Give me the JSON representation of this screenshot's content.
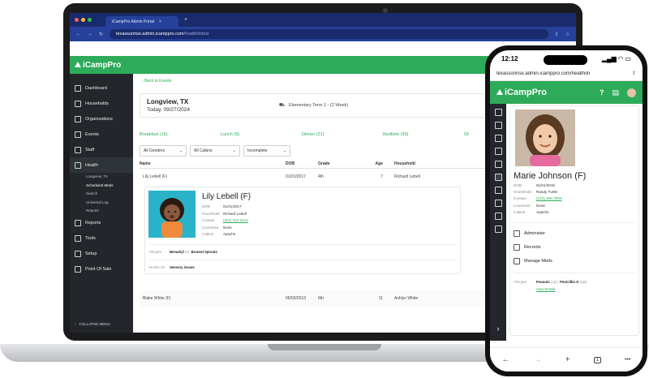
{
  "browser": {
    "tab_title": "iCampPro Admin Portal",
    "new_tab": "+",
    "url_host": "texassunrise.admin.icamppro.com",
    "url_path": "/health/inbox"
  },
  "app": {
    "brand": "iCampPro"
  },
  "sidebar": {
    "items": [
      {
        "label": "Dashboard"
      },
      {
        "label": "Households"
      },
      {
        "label": "Organizations"
      },
      {
        "label": "Events"
      },
      {
        "label": "Staff"
      },
      {
        "label": "Health"
      }
    ],
    "health_sub": [
      "Longview, TX",
      "Scheduled Meds",
      "Search",
      "Universal Log",
      "Reports"
    ],
    "items_after": [
      {
        "label": "Reports"
      },
      {
        "label": "Tools"
      },
      {
        "label": "Setup"
      },
      {
        "label": "Point Of Sale"
      }
    ],
    "collapse": "COLLAPSE MENU"
  },
  "main": {
    "back": "Back to Events",
    "event_location": "Longview, TX",
    "event_date": "Today, 09/27/2024",
    "term": "Elementary Term 1 - (2 Week)",
    "meals": [
      "Breakfast (15)",
      "Lunch (5)",
      "Dinner (21)",
      "Bedtime (30)",
      "Ot"
    ],
    "filters": [
      "All Genders",
      "All Cabins",
      "Incomplete"
    ],
    "columns": [
      "Name",
      "DOB",
      "Grade",
      "Age",
      "Household"
    ],
    "row1": {
      "name": "Lily Lebell (F)",
      "dob": "01/01/2017",
      "grade": "4th",
      "age": "7",
      "household": "Richard Lebell"
    },
    "detail": {
      "name": "Lily Lebell",
      "gender": "(F)",
      "fields": [
        {
          "k": "DOB",
          "v": "01/01/2017"
        },
        {
          "k": "Household",
          "v": "Richard Lebell"
        },
        {
          "k": "Contact",
          "v": "(321) 321-3214"
        },
        {
          "k": "Counselor",
          "v": "None"
        },
        {
          "k": "Cabins",
          "v": "Apache"
        }
      ],
      "allergies_label": "Allergies",
      "allergy1": "Benadryl",
      "allergy1_sev": "(5)",
      "allergy2": "Brussel Sprouts",
      "health_label": "Health Info",
      "health_value": "Sensory issues"
    },
    "row2": {
      "name": "Blake White (F)",
      "dob": "06/03/2013",
      "grade": "6th",
      "age": "11",
      "household": "Ashlyn White"
    }
  },
  "phone": {
    "time": "12:12",
    "url": "texassunrise.admin.icamppro.com/health/in",
    "brand": "iCampPro",
    "camper": {
      "name": "Marie Johnson",
      "gender": "(F)",
      "fields": [
        {
          "k": "DOB",
          "v": "01/01/2015"
        },
        {
          "k": "Household",
          "v": "Randy Turtle"
        },
        {
          "k": "Contact",
          "v": "(123) 456-7899"
        },
        {
          "k": "Counselor",
          "v": "None"
        },
        {
          "k": "Cabins",
          "v": "Apache"
        }
      ]
    },
    "actions": [
      "Administer",
      "Records",
      "Manage Meds"
    ],
    "allergies_label": "Allergies",
    "allergy1": "Peanuts",
    "allergy1_sev": "(1pt)",
    "allergy2": "Penicillin G",
    "allergy2_sev": "(6pt)",
    "view_details": "View Details",
    "nav": [
      "←",
      "→",
      "+",
      "1",
      "•••"
    ]
  },
  "colors": {
    "green": "#2dab5a",
    "sidebar": "#23272b",
    "chrome": "#1a2b6d"
  }
}
